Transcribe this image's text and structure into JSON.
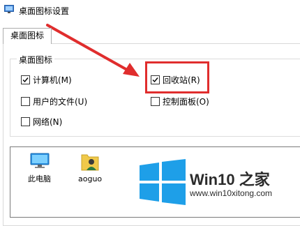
{
  "window": {
    "title": "桌面图标设置"
  },
  "tab": {
    "label": "桌面图标"
  },
  "group": {
    "label": "桌面图标",
    "checkboxes": [
      {
        "label": "计算机(M)",
        "checked": true
      },
      {
        "label": "回收站(R)",
        "checked": true
      },
      {
        "label": "用户的文件(U)",
        "checked": false
      },
      {
        "label": "控制面板(O)",
        "checked": false
      },
      {
        "label": "网络(N)",
        "checked": false
      }
    ]
  },
  "desktop_icons": [
    {
      "label": "此电脑",
      "icon": "computer-icon"
    },
    {
      "label": "aoguo",
      "icon": "user-folder-icon"
    }
  ],
  "watermark": {
    "brand": "Win10 之家",
    "url": "www.win10xitong.com"
  },
  "colors": {
    "annotation": "#e02d2d",
    "win_logo": "#1e9fe8"
  }
}
